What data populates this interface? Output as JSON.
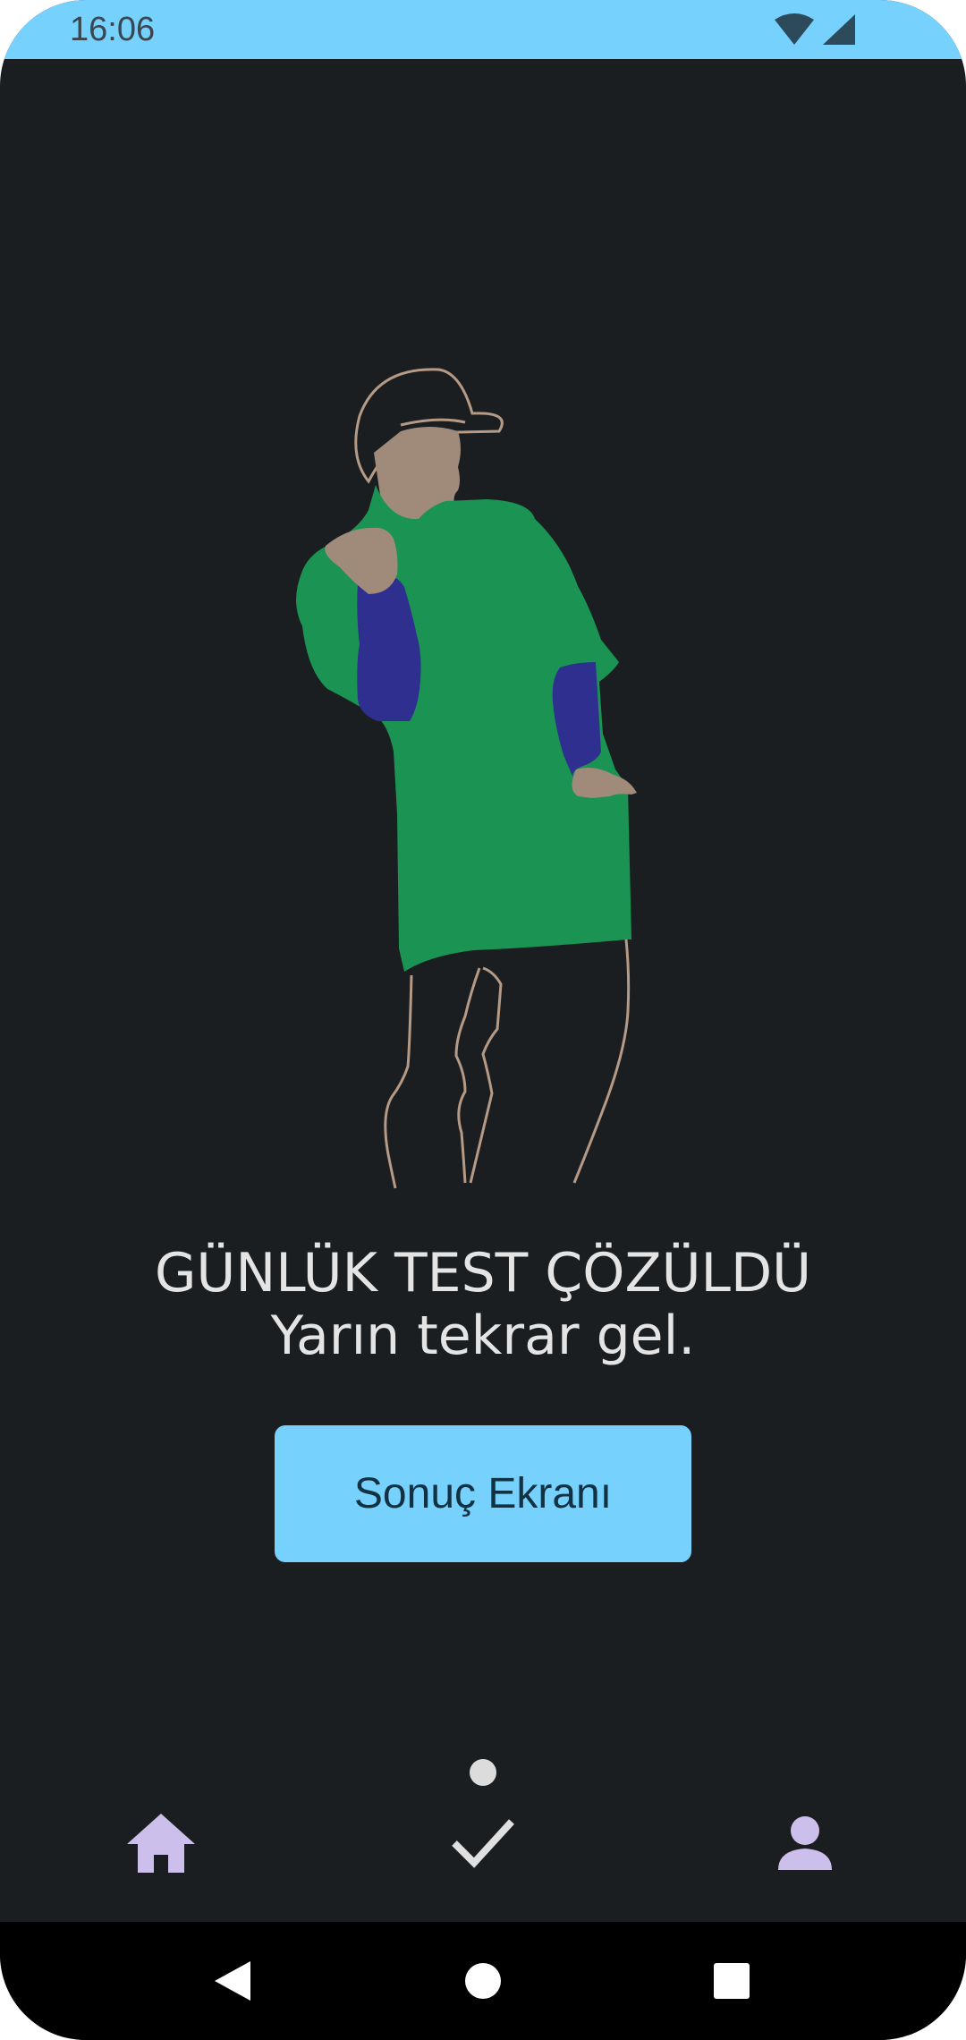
{
  "status_bar": {
    "time": "16:06",
    "icons": [
      "wifi-icon",
      "cellular-signal-icon"
    ],
    "background": "#76d1fd"
  },
  "illustration": {
    "icon": "dancing-person-illustration",
    "colors": {
      "shirt": "#1a9353",
      "sleeves": "#2e2f8f",
      "skin": "#a08b7a",
      "outline": "#b59a86"
    }
  },
  "message": {
    "title": "GÜNLÜK TEST ÇÖZÜLDÜ",
    "subtitle": "Yarın tekrar gel."
  },
  "result_button": {
    "label": "Sonuç Ekranı",
    "color": "#76d1fd"
  },
  "bottom_nav": {
    "items": [
      {
        "icon": "home-icon",
        "active": false
      },
      {
        "icon": "check-icon",
        "active": true
      },
      {
        "icon": "person-icon",
        "active": false
      }
    ],
    "icon_color": "#cdbfec",
    "active_color": "#e0e0e0"
  },
  "system_nav": {
    "buttons": [
      "back-icon",
      "home-circle-icon",
      "recents-icon"
    ]
  },
  "colors": {
    "background": "#1b1e21",
    "text": "#e4e4e4"
  }
}
